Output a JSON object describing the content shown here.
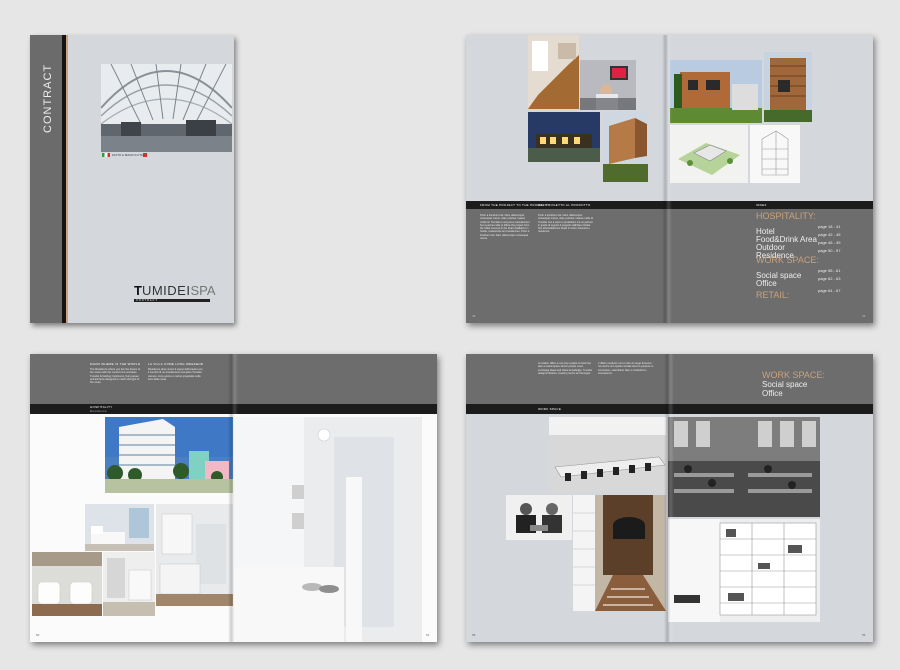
{
  "cover": {
    "vertical_title": "CONTRACT",
    "flag_caption": "FATTO A MANO IN ITALIA",
    "logo_t": "T",
    "logo_umidei": "UMIDEI",
    "logo_spa": "SPA",
    "logo_sub": "CONTRACT"
  },
  "spread_index": {
    "col_header_1": "FROM THE PROJECT TO THE PRODUCT",
    "col_header_2": "DAL PROGETTO AL PRODOTTO",
    "index_label": "INDEX",
    "body_1": "Proin a tincidunt nisi. Nam ullamcorper consequat metus, vitae pulvinar massa mollis id. Tumidei is not just a manufacturer but a partner able to follow the project from the initial concept to the final installation in hotels, restaurants and residences. Proin a tincidunt nisi. Nam ullamcorper consequat metus.",
    "body_2": "Proin a tincidunt nisi. Nam ullamcorper consequat metus, vitae pulvinar massa mollis id. Tumidei non è solo un produttore ma un partner in grado di seguire il progetto dall'idea iniziale fino all'installazione finale in hotel, ristoranti e residenze.",
    "page_left": "48",
    "page_right": "49",
    "sections": [
      {
        "heading": "HOSPITALITY:",
        "items": [
          {
            "label": "Hotel",
            "pages": "page 18 - 41"
          },
          {
            "label": "Food&Drink Area",
            "pages": "page 42 - 45"
          },
          {
            "label": "Outdoor",
            "pages": "page 46 - 49"
          },
          {
            "label": "Residence",
            "pages": "page 50 - 57"
          }
        ]
      },
      {
        "heading": "WORK SPACE:",
        "items": [
          {
            "label": "Social space",
            "pages": "page 58 - 61"
          },
          {
            "label": "Office",
            "pages": "page 62 - 63"
          }
        ]
      },
      {
        "heading": "RETAIL:",
        "items": [],
        "pages": "page 64 - 67"
      }
    ]
  },
  "spread_hospitality": {
    "col_header_1": "MIAMI WHERE IS THE WORLD",
    "col_header_2": "LA VILLA COME LONG WEEKEND",
    "section_label": "HOSPITALITY",
    "section_sub": "Residence",
    "body_1": "The Residence where you live the dream of the ocean with the comfort of a complete Tumidei furnishing: bedrooms, living areas and kitchens designed to match the light of the coast.",
    "body_2": "Residence dove vivere il sogno dell'oceano con il comfort di un arredamento completo Tumidei: camere, zone giorno e cucine progettate sulla luce della costa.",
    "page_left": "50",
    "page_right": "51"
  },
  "spread_work": {
    "heading": "WORK SPACE:",
    "item_1": "Social space",
    "item_2": "Office",
    "section_label": "WORK SPACE",
    "body_1": "A modern office is not only a place of work but also a social space where people meet, exchange ideas and share knowledge. Tumidei designs libraries, meeting rooms and lounges.",
    "body_2": "L'ufficio moderno non è solo un luogo di lavoro ma anche uno spazio sociale dove le persone si incontrano, scambiano idee e condividono conoscenze.",
    "page_left": "58",
    "page_right": "59"
  },
  "colors": {
    "page_grey": "#d4d7dc",
    "band_grey": "#6d6d6d",
    "black_band": "#1c1c1c",
    "accent": "#c9a27c",
    "background": "#e6e6e6"
  }
}
